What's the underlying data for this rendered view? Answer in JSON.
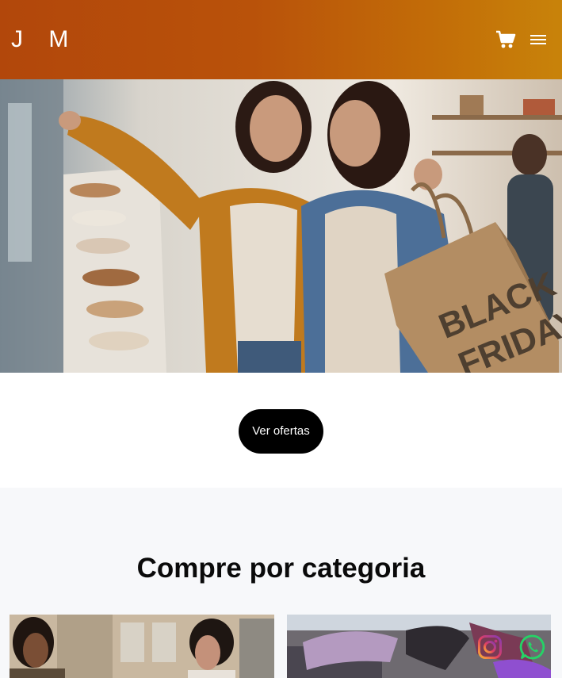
{
  "header": {
    "logo": "J M",
    "cart_icon": "shopping-cart-icon",
    "menu_icon": "hamburger-menu-icon"
  },
  "hero": {
    "bag_text_line1": "BLACK",
    "bag_text_line2": "FRIDAY"
  },
  "cta": {
    "label": "Ver ofertas"
  },
  "categories": {
    "title": "Compre por categoria"
  },
  "social": {
    "instagram_icon": "instagram-icon",
    "whatsapp_icon": "whatsapp-icon"
  },
  "colors": {
    "header_gradient_start": "#b2470b",
    "header_gradient_end": "#c8830a",
    "cta_background": "#000000",
    "section_background": "#f7f8fa"
  }
}
